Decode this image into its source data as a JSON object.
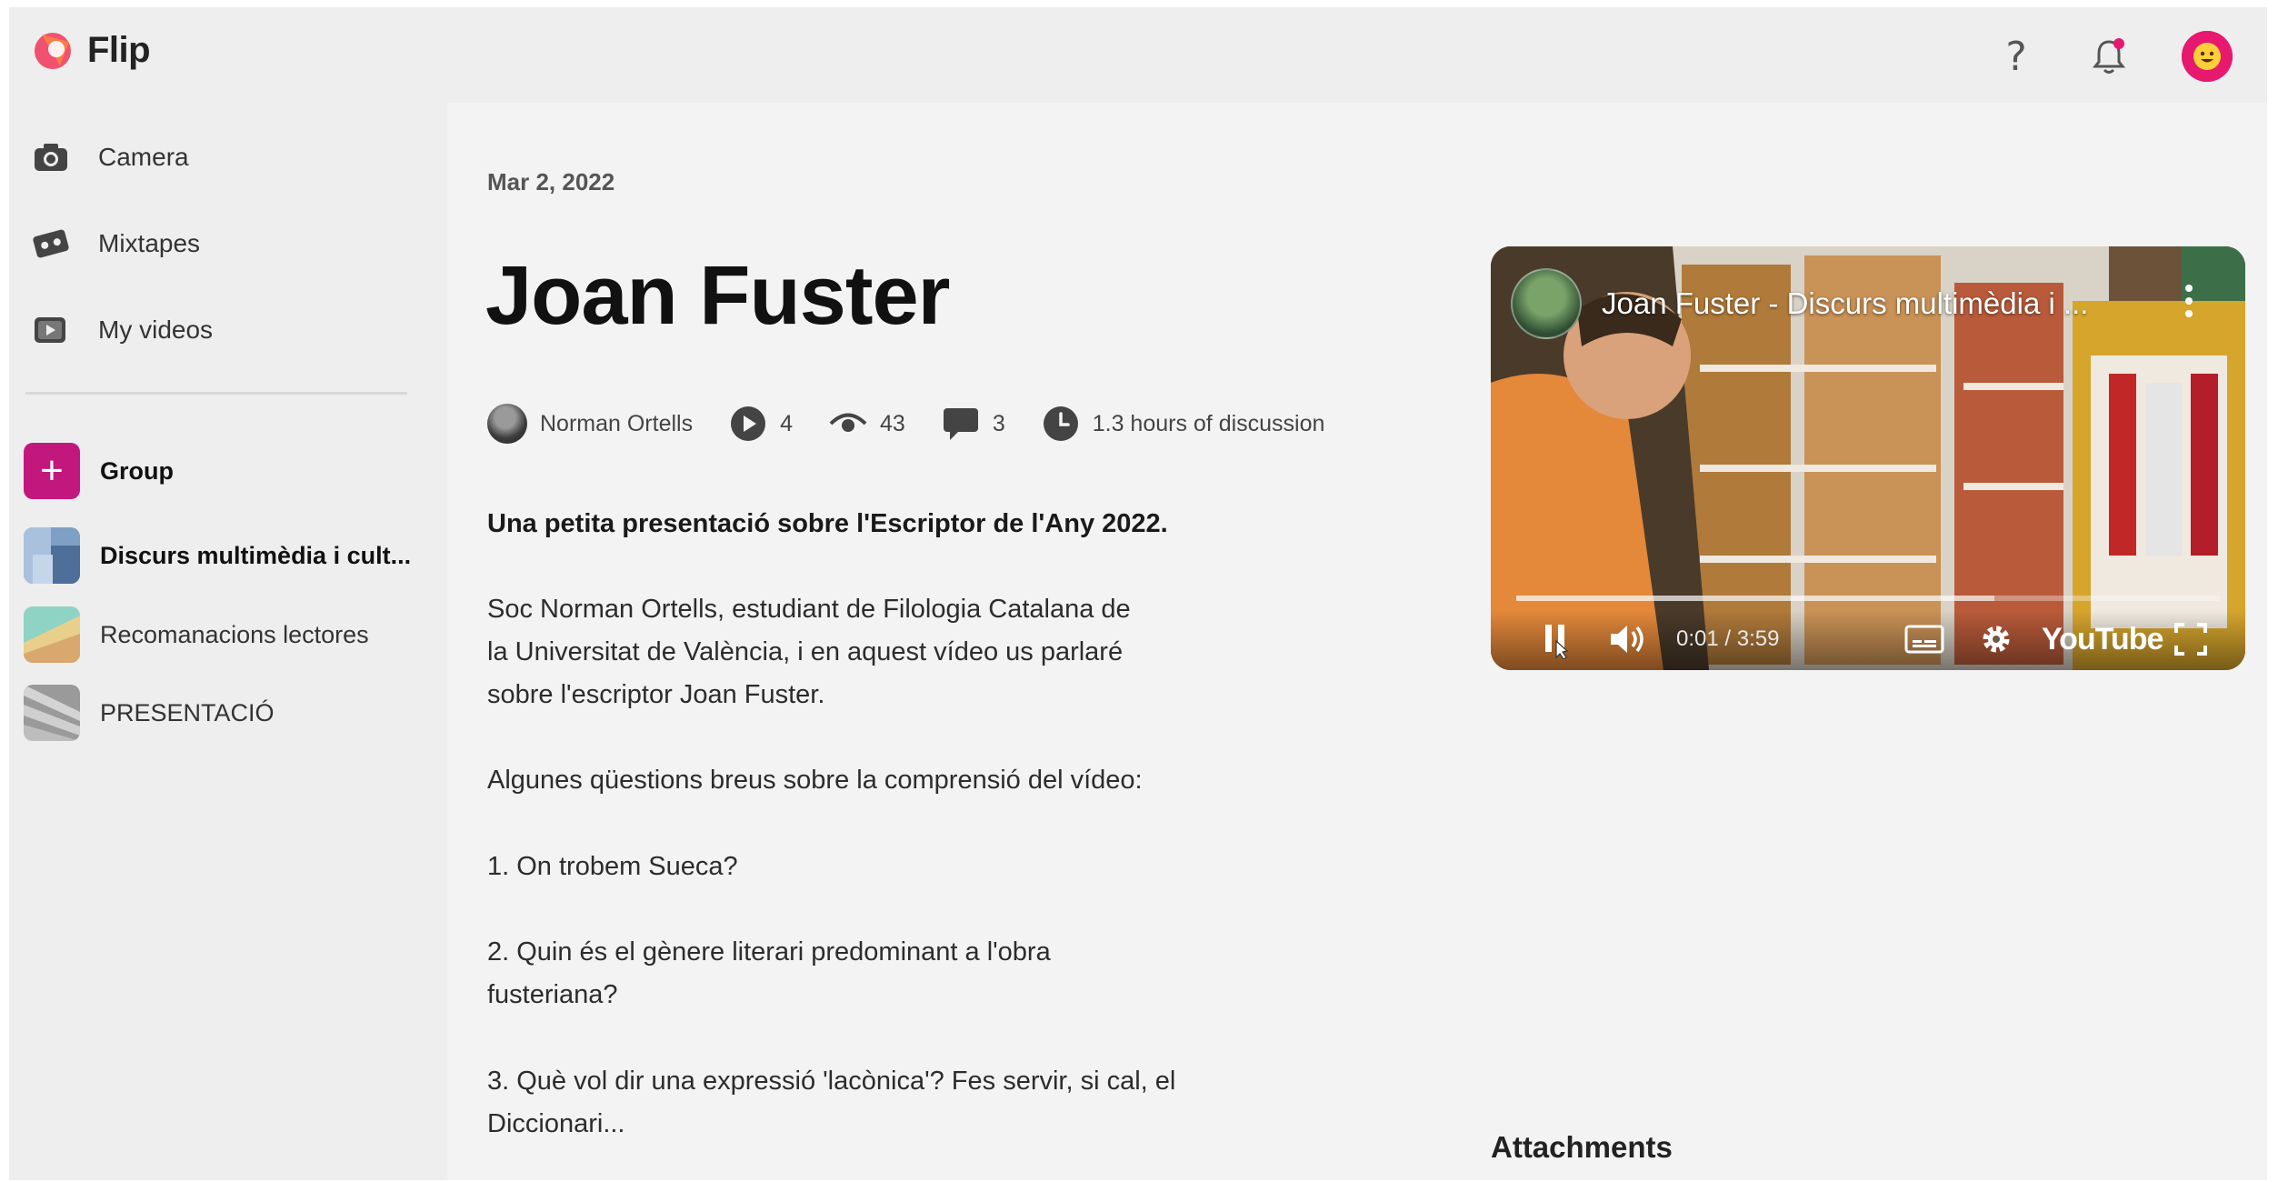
{
  "app": {
    "name": "Flip"
  },
  "header": {
    "help_icon": "question-mark-icon",
    "notification_icon": "bell-icon",
    "avatar_icon": "user-avatar-icon",
    "accent_color": "#e6196f"
  },
  "sidebar": {
    "nav": [
      {
        "label": "Camera",
        "icon": "camera-icon"
      },
      {
        "label": "Mixtapes",
        "icon": "mixtape-icon"
      },
      {
        "label": "My videos",
        "icon": "video-icon"
      }
    ],
    "group_button": {
      "label": "Group",
      "icon": "plus-icon",
      "color": "#c2187e"
    },
    "groups": [
      {
        "label": "Discurs multimèdia i cult...",
        "active": true
      },
      {
        "label": "Recomanacions lectores",
        "active": false
      },
      {
        "label": "PRESENTACIÓ",
        "active": false
      }
    ]
  },
  "topic": {
    "date": "Mar 2, 2022",
    "title": "Joan Fuster",
    "author": "Norman Ortells",
    "responses": "4",
    "views": "43",
    "comments": "3",
    "discussion": "1.3 hours of discussion",
    "lead": "Una petita presentació sobre l'Escriptor de l'Any 2022.",
    "paragraphs": [
      [
        "Soc Norman Ortells, estudiant de Filologia Catalana de",
        "la Universitat de València, i en aquest vídeo us parlaré",
        "sobre l'escriptor Joan Fuster."
      ],
      [
        "Algunes qüestions breus sobre la comprensió del vídeo:"
      ],
      [
        "1. On trobem Sueca?"
      ],
      [
        "2. Quin és el gènere literari predominant a l'obra",
        "fusteriana?"
      ],
      [
        "3. Què vol dir una expressió 'lacònica'? Fes servir, si cal, el",
        "Diccionari..."
      ]
    ]
  },
  "video": {
    "title": "Joan Fuster - Discurs multimèdia i ...",
    "time": "0:01 / 3:59",
    "progress": 0.68,
    "brand": "YouTube"
  },
  "attachments": {
    "heading": "Attachments"
  }
}
